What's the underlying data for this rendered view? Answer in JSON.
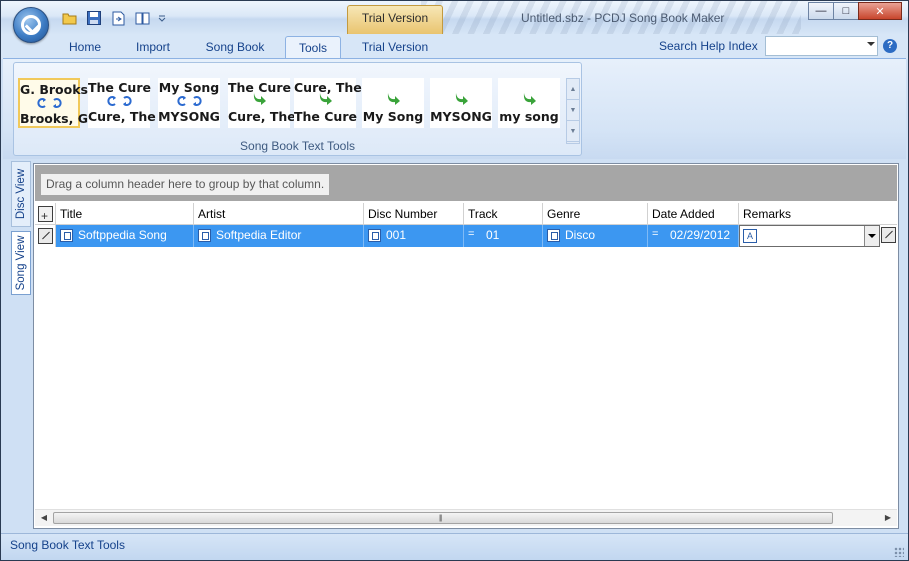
{
  "titlebar": {
    "trial_tab": "Trial Version",
    "window_title": "Untitled.sbz - PCDJ Song Book Maker",
    "controls": {
      "minimize": "—",
      "maximize": "□",
      "close": "✕"
    }
  },
  "ribbon_tabs": [
    {
      "label": "Home"
    },
    {
      "label": "Import"
    },
    {
      "label": "Song Book"
    },
    {
      "label": "Tools"
    },
    {
      "label": "Trial Version"
    }
  ],
  "help": {
    "label": "Search Help Index",
    "value": "",
    "icon": "?"
  },
  "gallery": {
    "group_label": "Song Book Text Tools",
    "items": [
      {
        "top": "G. Brooks",
        "bottom": "Brooks, G."
      },
      {
        "top": "The Cure",
        "bottom": "Cure, The"
      },
      {
        "top": "My Song",
        "bottom": "MYSONG"
      },
      {
        "top": "The Cure",
        "bottom": "Cure, The"
      },
      {
        "top": "Cure, The",
        "bottom": "The Cure"
      },
      {
        "bottom": "My Song"
      },
      {
        "bottom": "MYSONG"
      },
      {
        "bottom": "my song"
      }
    ]
  },
  "side_tabs": {
    "disc_view": "Disc View",
    "song_view": "Song View"
  },
  "grid": {
    "group_hint": "Drag a column header here to group by that column.",
    "columns": [
      "Title",
      "Artist",
      "Disc Number",
      "Track",
      "Genre",
      "Date Added",
      "Remarks"
    ],
    "rows": [
      {
        "title": "Softppedia Song",
        "artist": "Softpedia Editor",
        "disc_number": "001",
        "track": "01",
        "genre": "Disco",
        "date_added": "02/29/2012",
        "remarks": ""
      }
    ]
  },
  "status": {
    "text": "Song Book Text Tools"
  }
}
